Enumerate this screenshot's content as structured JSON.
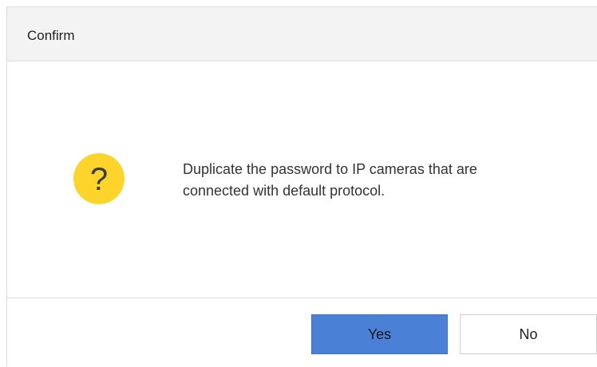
{
  "dialog": {
    "title": "Confirm",
    "icon": "question-icon",
    "icon_glyph": "?",
    "icon_color": "#fcd42a",
    "message_line1": "Duplicate the password to IP cameras that are",
    "message_line2": "connected with default protocol.",
    "buttons": {
      "yes_label": "Yes",
      "no_label": "No"
    },
    "accent_color": "#4a80d6"
  }
}
